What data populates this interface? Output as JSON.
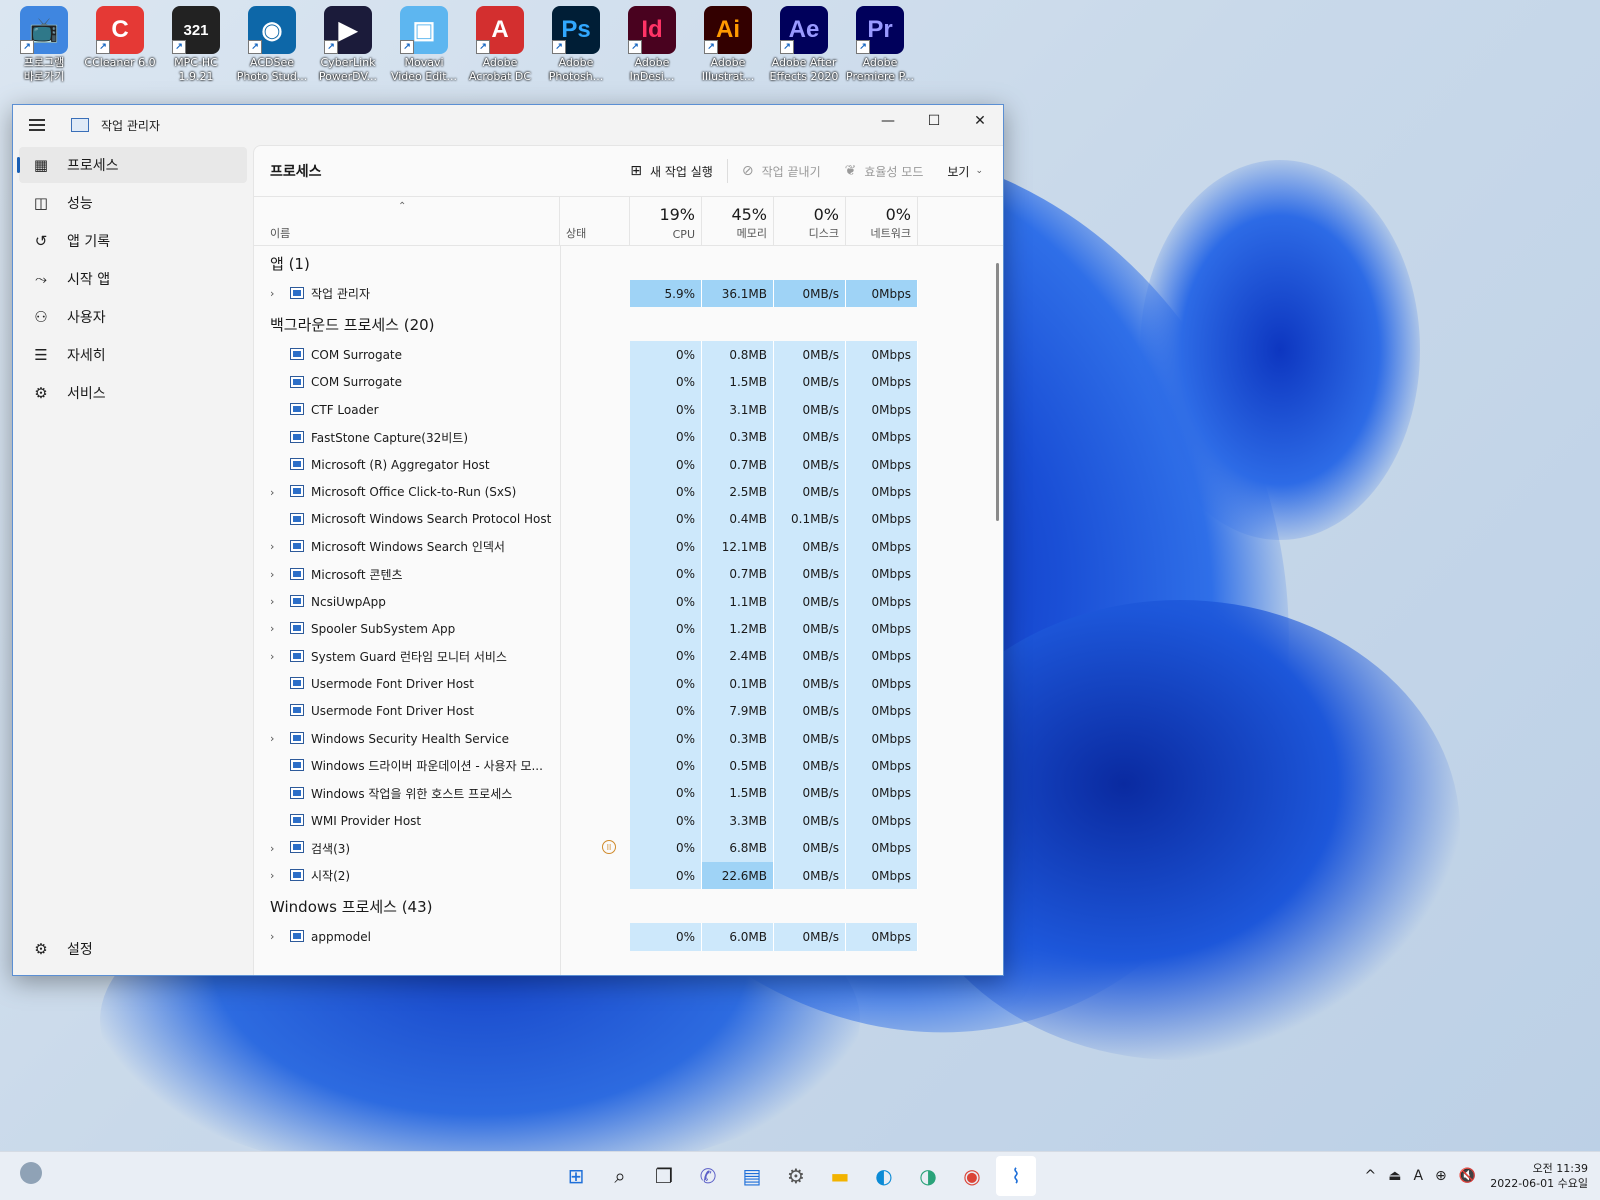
{
  "desktop": {
    "icons": [
      {
        "label": "프로그램\n바로가기",
        "glyph": "📺",
        "bg": "#3f86e0",
        "fg": "#fff"
      },
      {
        "label": "CCleaner 6.0",
        "glyph": "C",
        "bg": "#e53935",
        "fg": "#fff"
      },
      {
        "label": "MPC-HC\n1.9.21",
        "glyph": "321",
        "bg": "#222",
        "fg": "#fff"
      },
      {
        "label": "ACDSee\nPhoto Stud...",
        "glyph": "◉",
        "bg": "#0d67a8",
        "fg": "#fff"
      },
      {
        "label": "CyberLink\nPowerDV...",
        "glyph": "▶",
        "bg": "#1b1b3a",
        "fg": "#fff"
      },
      {
        "label": "Movavi\nVideo Edit...",
        "glyph": "▣",
        "bg": "#5db6f0",
        "fg": "#fff"
      },
      {
        "label": "Adobe\nAcrobat DC",
        "glyph": "A",
        "bg": "#d32f2f",
        "fg": "#fff"
      },
      {
        "label": "Adobe\nPhotosh...",
        "glyph": "Ps",
        "bg": "#001e36",
        "fg": "#31a8ff"
      },
      {
        "label": "Adobe\nInDesi...",
        "glyph": "Id",
        "bg": "#49021f",
        "fg": "#ff3366"
      },
      {
        "label": "Adobe\nIllustrat...",
        "glyph": "Ai",
        "bg": "#330000",
        "fg": "#ff9a00"
      },
      {
        "label": "Adobe After\nEffects 2020",
        "glyph": "Ae",
        "bg": "#00005b",
        "fg": "#9999ff"
      },
      {
        "label": "Adobe\nPremiere P...",
        "glyph": "Pr",
        "bg": "#00005b",
        "fg": "#9999ff"
      }
    ]
  },
  "window": {
    "title": "작업 관리자",
    "controls": {
      "minimize": "—",
      "maximize": "☐",
      "close": "✕"
    }
  },
  "nav": {
    "items": [
      {
        "label": "프로세스",
        "icon": "processes-icon",
        "glyph": "▦"
      },
      {
        "label": "성능",
        "icon": "performance-icon",
        "glyph": "◫"
      },
      {
        "label": "앱 기록",
        "icon": "app-history-icon",
        "glyph": "↺"
      },
      {
        "label": "시작 앱",
        "icon": "startup-icon",
        "glyph": "⤳"
      },
      {
        "label": "사용자",
        "icon": "users-icon",
        "glyph": "⚇"
      },
      {
        "label": "자세히",
        "icon": "details-icon",
        "glyph": "☰"
      },
      {
        "label": "서비스",
        "icon": "services-icon",
        "glyph": "⚙"
      }
    ],
    "settings": {
      "label": "설정",
      "glyph": "⚙"
    }
  },
  "toolbar": {
    "page_title": "프로세스",
    "run_new_task": "새 작업 실행",
    "end_task": "작업 끝내기",
    "efficiency_mode": "효율성 모드",
    "view": "보기"
  },
  "columns": {
    "name": "이름",
    "status": "상태",
    "cpu": {
      "pct": "19%",
      "label": "CPU"
    },
    "memory": {
      "pct": "45%",
      "label": "메모리"
    },
    "disk": {
      "pct": "0%",
      "label": "디스크"
    },
    "network": {
      "pct": "0%",
      "label": "네트워크"
    }
  },
  "groups": [
    {
      "title": "앱 (1)",
      "rows": [
        {
          "name": "작업 관리자",
          "expand": true,
          "cpu": "5.9%",
          "mem": "36.1MB",
          "disk": "0MB/s",
          "net": "0Mbps",
          "hl": true
        }
      ]
    },
    {
      "title": "백그라운드 프로세스 (20)",
      "rows": [
        {
          "name": "COM Surrogate",
          "expand": false,
          "cpu": "0%",
          "mem": "0.8MB",
          "disk": "0MB/s",
          "net": "0Mbps"
        },
        {
          "name": "COM Surrogate",
          "expand": false,
          "cpu": "0%",
          "mem": "1.5MB",
          "disk": "0MB/s",
          "net": "0Mbps"
        },
        {
          "name": "CTF Loader",
          "expand": false,
          "cpu": "0%",
          "mem": "3.1MB",
          "disk": "0MB/s",
          "net": "0Mbps"
        },
        {
          "name": "FastStone Capture(32비트)",
          "expand": false,
          "cpu": "0%",
          "mem": "0.3MB",
          "disk": "0MB/s",
          "net": "0Mbps"
        },
        {
          "name": "Microsoft (R) Aggregator Host",
          "expand": false,
          "cpu": "0%",
          "mem": "0.7MB",
          "disk": "0MB/s",
          "net": "0Mbps"
        },
        {
          "name": "Microsoft Office Click-to-Run (SxS)",
          "expand": true,
          "cpu": "0%",
          "mem": "2.5MB",
          "disk": "0MB/s",
          "net": "0Mbps"
        },
        {
          "name": "Microsoft Windows Search Protocol Host",
          "expand": false,
          "cpu": "0%",
          "mem": "0.4MB",
          "disk": "0.1MB/s",
          "net": "0Mbps"
        },
        {
          "name": "Microsoft Windows Search 인덱서",
          "expand": true,
          "cpu": "0%",
          "mem": "12.1MB",
          "disk": "0MB/s",
          "net": "0Mbps"
        },
        {
          "name": "Microsoft 콘텐츠",
          "expand": true,
          "cpu": "0%",
          "mem": "0.7MB",
          "disk": "0MB/s",
          "net": "0Mbps"
        },
        {
          "name": "NcsiUwpApp",
          "expand": true,
          "cpu": "0%",
          "mem": "1.1MB",
          "disk": "0MB/s",
          "net": "0Mbps"
        },
        {
          "name": "Spooler SubSystem App",
          "expand": true,
          "cpu": "0%",
          "mem": "1.2MB",
          "disk": "0MB/s",
          "net": "0Mbps"
        },
        {
          "name": "System Guard 런타임 모니터 서비스",
          "expand": true,
          "cpu": "0%",
          "mem": "2.4MB",
          "disk": "0MB/s",
          "net": "0Mbps"
        },
        {
          "name": "Usermode Font Driver Host",
          "expand": false,
          "cpu": "0%",
          "mem": "0.1MB",
          "disk": "0MB/s",
          "net": "0Mbps"
        },
        {
          "name": "Usermode Font Driver Host",
          "expand": false,
          "cpu": "0%",
          "mem": "7.9MB",
          "disk": "0MB/s",
          "net": "0Mbps"
        },
        {
          "name": "Windows Security Health Service",
          "expand": true,
          "cpu": "0%",
          "mem": "0.3MB",
          "disk": "0MB/s",
          "net": "0Mbps"
        },
        {
          "name": "Windows 드라이버 파운데이션 - 사용자 모...",
          "expand": false,
          "cpu": "0%",
          "mem": "0.5MB",
          "disk": "0MB/s",
          "net": "0Mbps"
        },
        {
          "name": "Windows 작업을 위한 호스트 프로세스",
          "expand": false,
          "cpu": "0%",
          "mem": "1.5MB",
          "disk": "0MB/s",
          "net": "0Mbps"
        },
        {
          "name": "WMI Provider Host",
          "expand": false,
          "cpu": "0%",
          "mem": "3.3MB",
          "disk": "0MB/s",
          "net": "0Mbps"
        },
        {
          "name": "검색(3)",
          "expand": true,
          "cpu": "0%",
          "mem": "6.8MB",
          "disk": "0MB/s",
          "net": "0Mbps",
          "suspended": true
        },
        {
          "name": "시작(2)",
          "expand": true,
          "cpu": "0%",
          "mem": "22.6MB",
          "disk": "0MB/s",
          "net": "0Mbps",
          "memhl": true
        }
      ]
    },
    {
      "title": "Windows 프로세스 (43)",
      "rows": [
        {
          "name": "appmodel",
          "expand": true,
          "cpu": "0%",
          "mem": "6.0MB",
          "disk": "0MB/s",
          "net": "0Mbps"
        }
      ]
    }
  ],
  "taskbar": {
    "apps": [
      {
        "name": "start-icon",
        "glyph": "⊞",
        "color": "#1e6fd9"
      },
      {
        "name": "search-icon",
        "glyph": "⌕",
        "color": "#222"
      },
      {
        "name": "task-view-icon",
        "glyph": "❐",
        "color": "#222"
      },
      {
        "name": "chat-icon",
        "glyph": "✆",
        "color": "#5b5fc7"
      },
      {
        "name": "store-icon",
        "glyph": "▤",
        "color": "#1e6fd9"
      },
      {
        "name": "settings-icon",
        "glyph": "⚙",
        "color": "#555"
      },
      {
        "name": "explorer-icon",
        "glyph": "▬",
        "color": "#f2b300"
      },
      {
        "name": "edge-icon",
        "glyph": "◐",
        "color": "#0c8bd6"
      },
      {
        "name": "edge-beta-icon",
        "glyph": "◑",
        "color": "#2aa37a"
      },
      {
        "name": "chrome-icon",
        "glyph": "◉",
        "color": "#db4437"
      },
      {
        "name": "task-manager-icon",
        "glyph": "⌇",
        "color": "#1e6fd9",
        "active": true
      }
    ],
    "tray": {
      "chevron": "^",
      "usb": "⏏",
      "ime": "A",
      "network": "⊕",
      "volume": "🔇",
      "time": "오전 11:39",
      "date": "2022-06-01 수요일"
    }
  }
}
